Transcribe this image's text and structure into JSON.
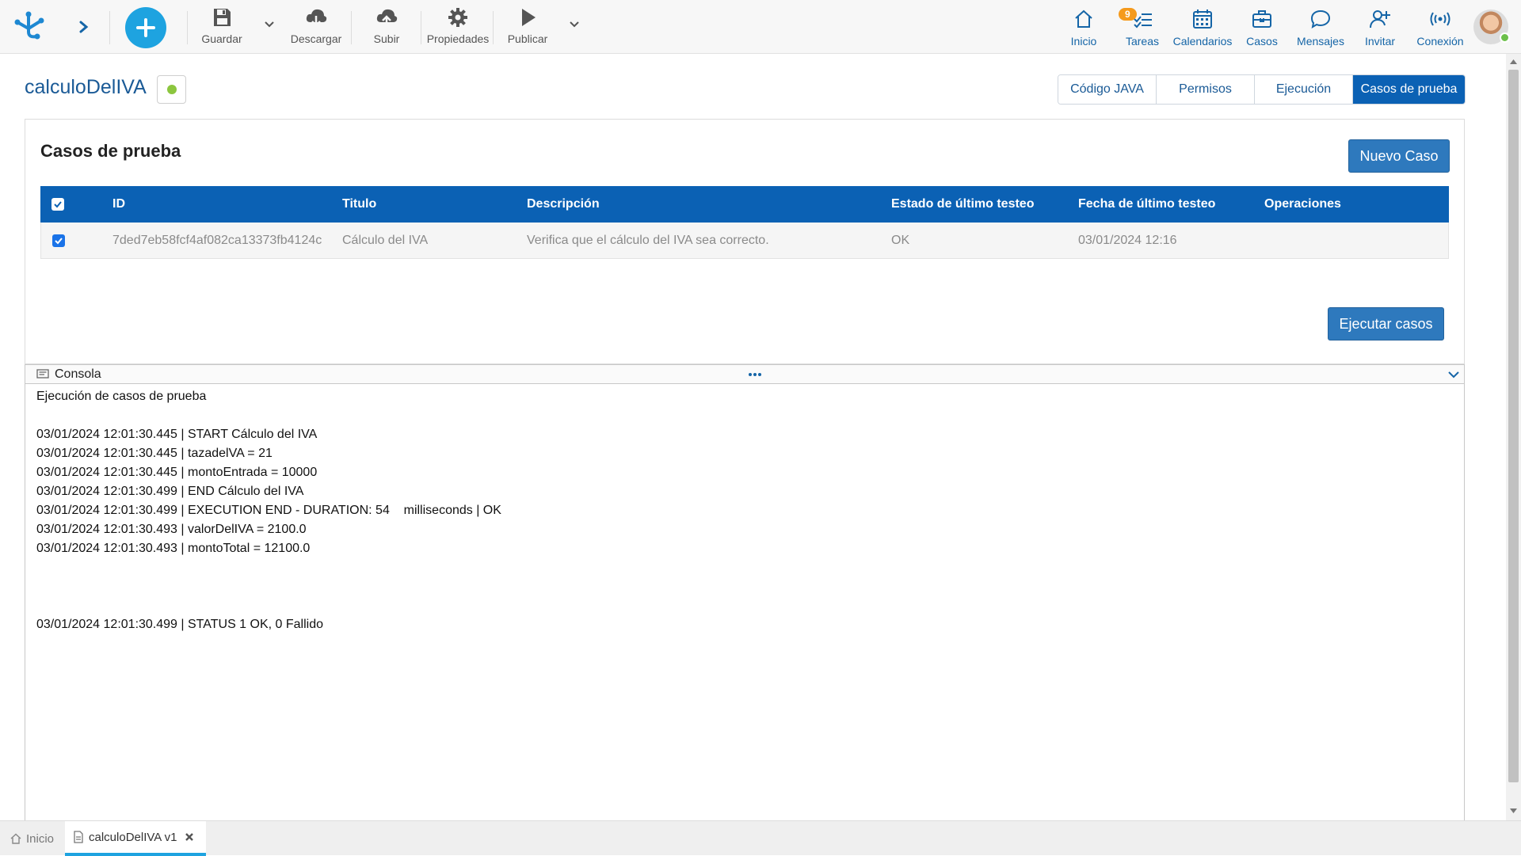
{
  "toolbar": {
    "add_label": "+",
    "tools": [
      "Guardar",
      "Descargar",
      "Subir",
      "Propiedades",
      "Publicar"
    ]
  },
  "nav": {
    "items": [
      {
        "label": "Inicio",
        "icon": "home-icon"
      },
      {
        "label": "Tareas",
        "icon": "tasks-icon",
        "badge": "9"
      },
      {
        "label": "Calendarios",
        "icon": "calendar-icon"
      },
      {
        "label": "Casos",
        "icon": "briefcase-icon"
      },
      {
        "label": "Mensajes",
        "icon": "chat-icon"
      },
      {
        "label": "Invitar",
        "icon": "invite-icon"
      },
      {
        "label": "Conexión",
        "icon": "connection-icon"
      }
    ]
  },
  "page": {
    "title": "calculoDelIVA",
    "status_color": "#8cc63f"
  },
  "tabs": [
    "Código JAVA",
    "Permisos",
    "Ejecución",
    "Casos de prueba"
  ],
  "panel": {
    "title": "Casos de prueba",
    "new_case_label": "Nuevo Caso",
    "run_cases_label": "Ejecutar casos"
  },
  "table": {
    "headers": [
      "ID",
      "Titulo",
      "Descripción",
      "Estado de último testeo",
      "Fecha de último testeo",
      "Operaciones"
    ],
    "rows": [
      {
        "id": "7ded7eb58fcf4af082ca13373fb4124c",
        "title": "Cálculo del IVA",
        "description": "Verifica que el cálculo del IVA sea correcto.",
        "status": "OK",
        "date": "03/01/2024 12:16",
        "operations": "",
        "checked": true
      }
    ]
  },
  "console": {
    "label": "Consola",
    "lines": [
      "Ejecución de casos de prueba",
      "",
      "03/01/2024 12:01:30.445 | START Cálculo del IVA",
      "03/01/2024 12:01:30.445 | tazadelVA = 21",
      "03/01/2024 12:01:30.445 | montoEntrada = 10000",
      "03/01/2024 12:01:30.499 | END Cálculo del IVA",
      "03/01/2024 12:01:30.499 | EXECUTION END - DURATION: 54    milliseconds | OK",
      "03/01/2024 12:01:30.493 | valorDelIVA = 2100.0",
      "03/01/2024 12:01:30.493 | montoTotal = 12100.0",
      "",
      "",
      "",
      "03/01/2024 12:01:30.499 | STATUS 1 OK, 0 Fallido"
    ]
  },
  "bottom_tabs": {
    "home": "Inicio",
    "doc": "calculoDelIVA v1"
  },
  "colors": {
    "accent": "#0b61b4",
    "add_button": "#1ea3e0",
    "badge": "#f59a1c"
  }
}
